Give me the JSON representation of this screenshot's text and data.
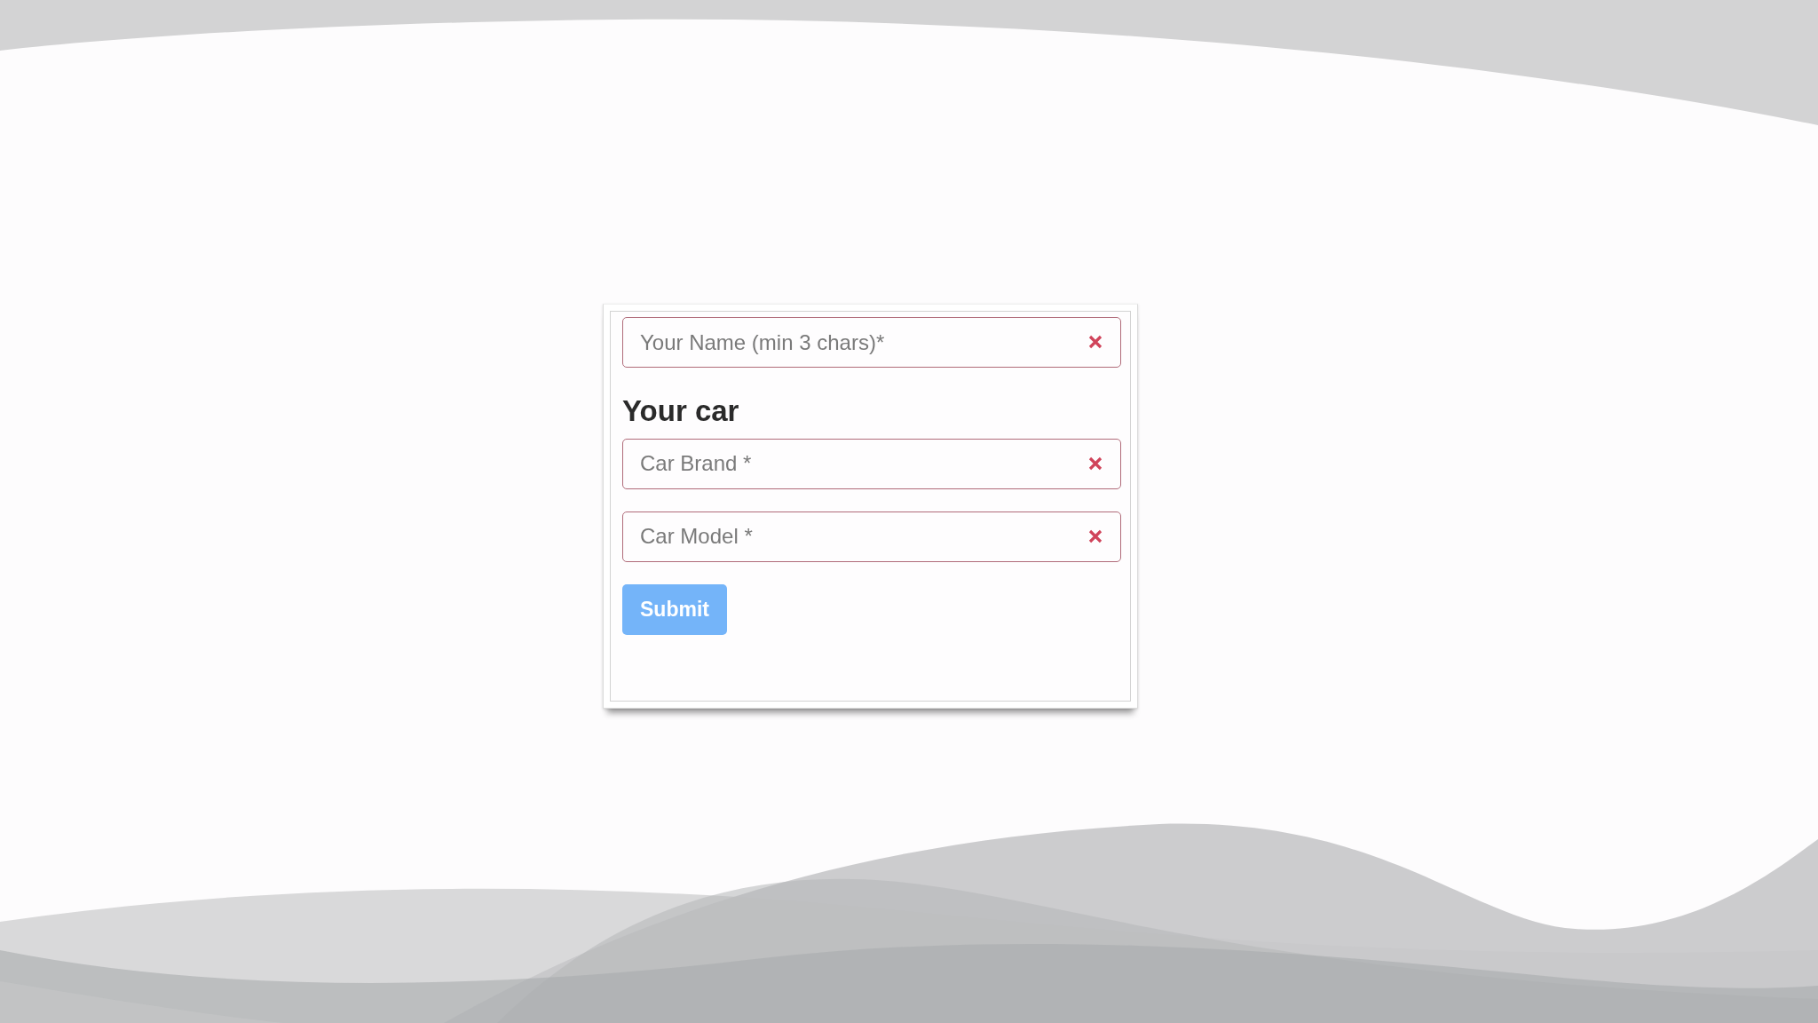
{
  "form": {
    "name_field": {
      "placeholder": "Your Name (min 3 chars)*",
      "invalid": true
    },
    "car_section": {
      "heading": "Your car",
      "fields": [
        {
          "placeholder": "Car Brand *",
          "invalid": true
        },
        {
          "placeholder": "Car Model *",
          "invalid": true
        }
      ]
    },
    "submit_button": {
      "label": "Submit",
      "disabled": true
    }
  }
}
